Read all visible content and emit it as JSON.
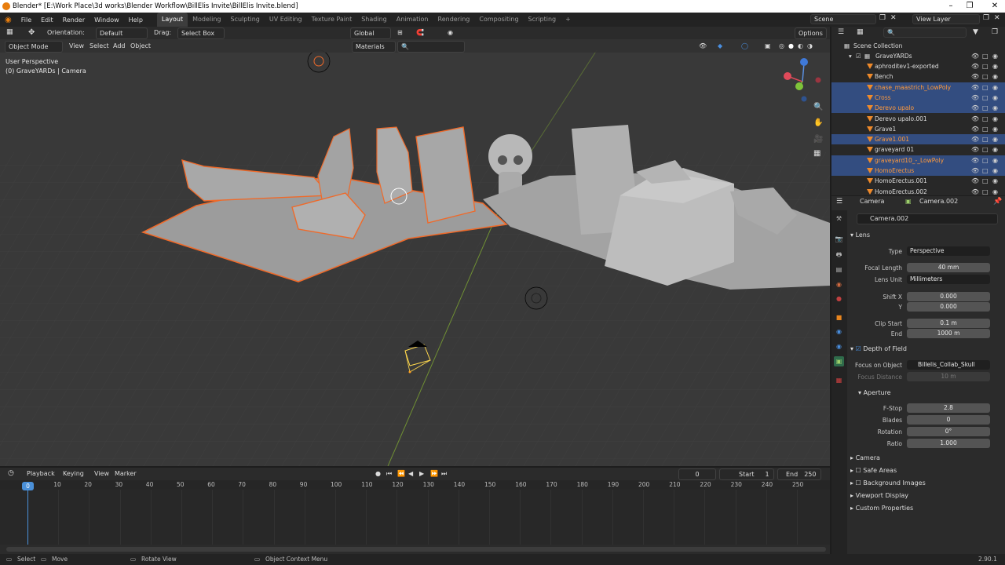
{
  "window": {
    "title": "Blender* [E:\\Work Place\\3d works\\Blender Workflow\\BillElis Invite\\BillElis Invite.blend]"
  },
  "menu": [
    "File",
    "Edit",
    "Render",
    "Window",
    "Help"
  ],
  "workspaces": [
    "Layout",
    "Modeling",
    "Sculpting",
    "UV Editing",
    "Texture Paint",
    "Shading",
    "Animation",
    "Rendering",
    "Compositing",
    "Scripting"
  ],
  "active_workspace": "Layout",
  "scene": {
    "name": "Scene",
    "view_layer": "View Layer"
  },
  "tool_header": {
    "orientation_label": "Orientation:",
    "orientation_value": "Default",
    "drag_label": "Drag:",
    "drag_value": "Select Box",
    "transform_orientation": "Global",
    "options": "Options"
  },
  "viewport_header": {
    "mode": "Object Mode",
    "menus": [
      "View",
      "Select",
      "Add",
      "Object"
    ],
    "shading_color": "Materials"
  },
  "viewport_overlay": {
    "view_name": "User Perspective",
    "context": "(0) GraveYARDs | Camera"
  },
  "gizmo_axes": {
    "x": "X",
    "y": "Y",
    "z": "Z"
  },
  "outliner": {
    "root": "Scene Collection",
    "collection": "GraveYARDs",
    "items": [
      {
        "name": "aphroditev1-exported",
        "selected": false
      },
      {
        "name": "Bench",
        "selected": false
      },
      {
        "name": "chase_maastrich_LowPoly",
        "selected": true
      },
      {
        "name": "Cross",
        "selected": true
      },
      {
        "name": "Derevo upalo",
        "selected": true
      },
      {
        "name": "Derevo upalo.001",
        "selected": false
      },
      {
        "name": "Grave1",
        "selected": false
      },
      {
        "name": "Grave1.001",
        "selected": true
      },
      {
        "name": "graveyard 01",
        "selected": false
      },
      {
        "name": "graveyard10_-_LowPoly",
        "selected": true
      },
      {
        "name": "HomoErectus",
        "selected": true
      },
      {
        "name": "HomoErectus.001",
        "selected": false
      },
      {
        "name": "HomoErectus.002",
        "selected": false
      }
    ]
  },
  "properties": {
    "breadcrumb_object": "Camera",
    "breadcrumb_data": "Camera.002",
    "data_name": "Camera.002",
    "lens": {
      "header": "Lens",
      "type_label": "Type",
      "type_value": "Perspective",
      "focal_label": "Focal Length",
      "focal_value": "40 mm",
      "unit_label": "Lens Unit",
      "unit_value": "Millimeters",
      "shiftx_label": "Shift X",
      "shiftx_value": "0.000",
      "shifty_label": "Y",
      "shifty_value": "0.000",
      "clipstart_label": "Clip Start",
      "clipstart_value": "0.1 m",
      "clipend_label": "End",
      "clipend_value": "1000 m"
    },
    "dof": {
      "header": "Depth of Field",
      "focus_obj_label": "Focus on Object",
      "focus_obj_value": "Billelis_Collab_Skull",
      "focus_dist_label": "Focus Distance",
      "focus_dist_value": "10 m",
      "aperture_header": "Aperture",
      "fstop_label": "F-Stop",
      "fstop_value": "2.8",
      "blades_label": "Blades",
      "blades_value": "0",
      "rotation_label": "Rotation",
      "rotation_value": "0°",
      "ratio_label": "Ratio",
      "ratio_value": "1.000"
    },
    "collapsed_sections": [
      "Camera",
      "Safe Areas",
      "Background Images",
      "Viewport Display",
      "Custom Properties"
    ]
  },
  "timeline": {
    "menus": [
      "Playback",
      "Keying",
      "View",
      "Marker"
    ],
    "current_frame": "0",
    "start_label": "Start",
    "start_value": "1",
    "end_label": "End",
    "end_value": "250",
    "ticks": [
      "0",
      "10",
      "20",
      "30",
      "40",
      "50",
      "60",
      "70",
      "80",
      "90",
      "100",
      "110",
      "120",
      "130",
      "140",
      "150",
      "160",
      "170",
      "180",
      "190",
      "200",
      "210",
      "220",
      "230",
      "240",
      "250"
    ]
  },
  "statusbar": {
    "select": "Select",
    "move": "Move",
    "rotate": "Rotate View",
    "context": "Object Context Menu",
    "version": "2.90.1"
  },
  "colors": {
    "selection_outline": "#ef6a2a",
    "accent_blue": "#4772b3",
    "frame_marker": "#4a90d9"
  }
}
